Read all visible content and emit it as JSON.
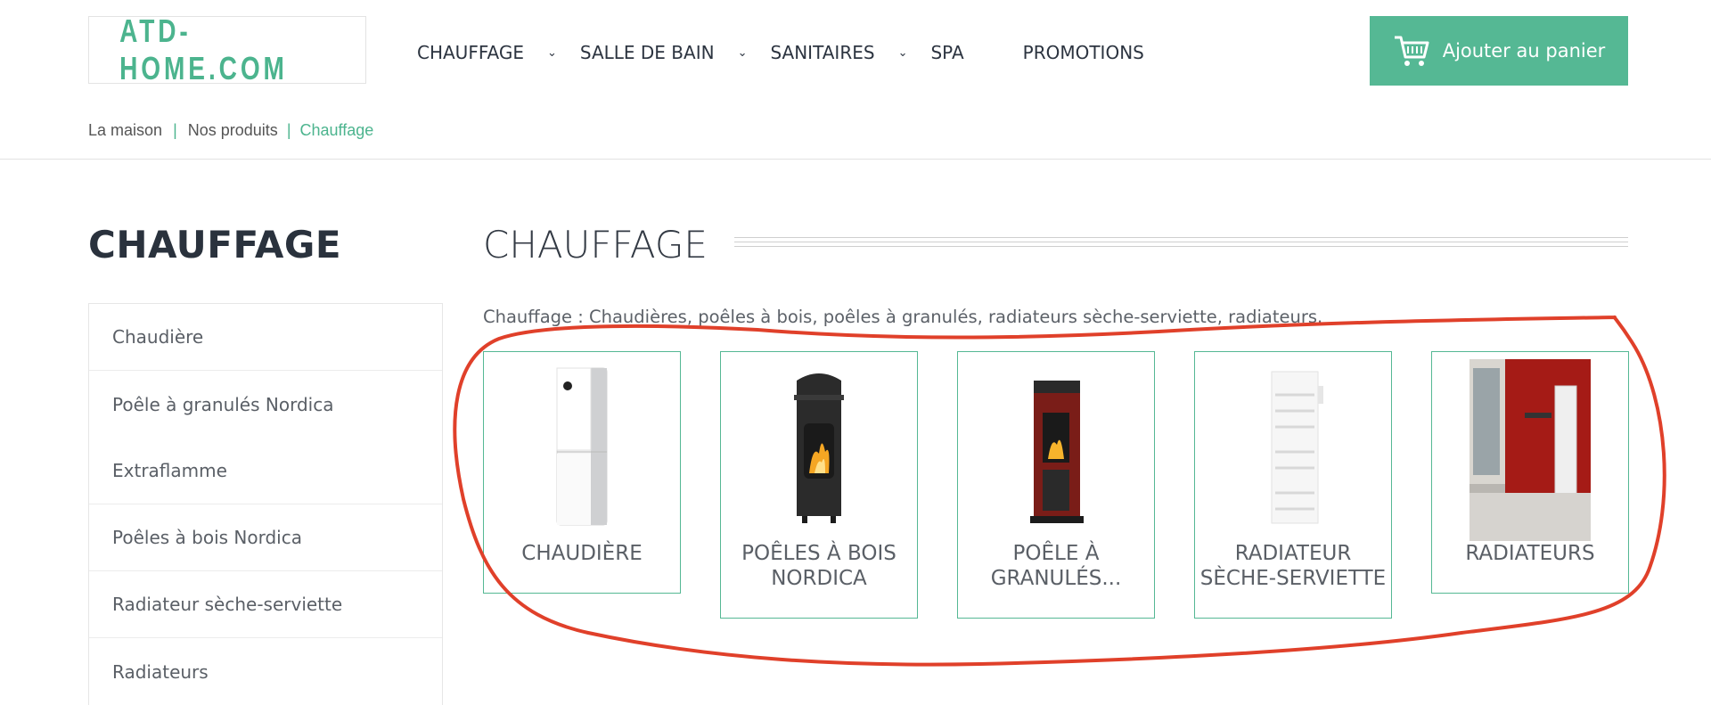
{
  "header": {
    "logo": "ATD-HOME.COM",
    "nav": [
      {
        "label": "CHAUFFAGE",
        "has_dropdown": true
      },
      {
        "label": "SALLE DE BAIN",
        "has_dropdown": true
      },
      {
        "label": "SANITAIRES",
        "has_dropdown": true
      },
      {
        "label": "SPA",
        "has_dropdown": false
      },
      {
        "label": "PROMOTIONS",
        "has_dropdown": false
      }
    ],
    "cart_label": "Ajouter au panier"
  },
  "breadcrumb": {
    "items": [
      "La maison",
      "Nos produits",
      "Chauffage"
    ],
    "separator": "|"
  },
  "sidebar": {
    "title": "CHAUFFAGE",
    "items": [
      "Chaudière",
      "Poêle à granulés Nordica",
      "Extraflamme",
      "Poêles à bois Nordica",
      "Radiateur sèche-serviette",
      "Radiateurs"
    ]
  },
  "main": {
    "title": "CHAUFFAGE",
    "description": "Chauffage : Chaudières, poêles à bois, poêles à granulés, radiateurs sèche-serviette, radiateurs.",
    "categories": [
      {
        "label_line1": "CHAUDIÈRE",
        "label_line2": ""
      },
      {
        "label_line1": "POÊLES À BOIS",
        "label_line2": "NORDICA"
      },
      {
        "label_line1": "POÊLE À",
        "label_line2": "GRANULÉS..."
      },
      {
        "label_line1": "RADIATEUR",
        "label_line2": "SÈCHE-SERVIETTE"
      },
      {
        "label_line1": "RADIATEURS",
        "label_line2": ""
      }
    ]
  },
  "colors": {
    "accent": "#55b894",
    "annotation": "#e0402a"
  }
}
